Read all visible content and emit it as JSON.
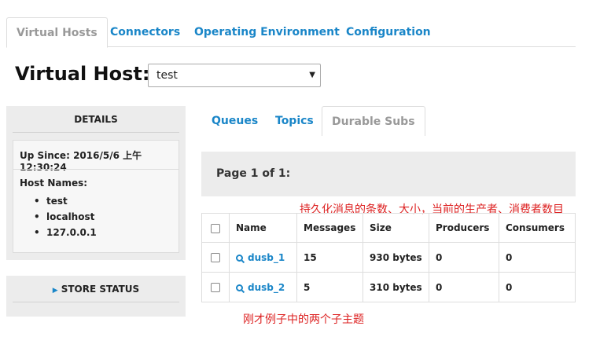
{
  "top_tabs": [
    {
      "label": "Virtual Hosts",
      "active": true
    },
    {
      "label": "Connectors",
      "active": false
    },
    {
      "label": "Operating Environment",
      "active": false
    },
    {
      "label": "Configuration",
      "active": false
    }
  ],
  "virtual_host": {
    "title": "Virtual Host:",
    "selected": "test"
  },
  "details": {
    "header": "DETAILS",
    "up_since_label": "Up Since:",
    "up_since_value": "2016/5/6 上午12:30:24",
    "host_names_label": "Host Names:",
    "host_names": [
      "test",
      "localhost",
      "127.0.0.1"
    ]
  },
  "store_status": {
    "label": "STORE STATUS"
  },
  "sub_tabs": [
    {
      "label": "Queues",
      "active": false
    },
    {
      "label": "Topics",
      "active": false
    },
    {
      "label": "Durable Subs",
      "active": true
    }
  ],
  "pager": {
    "text": "Page 1 of 1:"
  },
  "annotations": {
    "columns_note": "持久化消息的条数、大小，当前的生产者、消费者数目",
    "rows_note": "刚才例子中的两个子主题"
  },
  "table": {
    "columns": [
      "Name",
      "Messages",
      "Size",
      "Producers",
      "Consumers"
    ],
    "rows": [
      {
        "name": "dusb_1",
        "messages": "15",
        "size": "930 bytes",
        "producers": "0",
        "consumers": "0"
      },
      {
        "name": "dusb_2",
        "messages": "5",
        "size": "310 bytes",
        "producers": "0",
        "consumers": "0"
      }
    ]
  },
  "colors": {
    "link": "#1a86c8",
    "annotation": "#dd2222",
    "panel": "#ececec"
  },
  "icons": {
    "row_link": "magnifier-icon",
    "store_toggle": "triangle-right-icon",
    "select_caret": "caret-down-icon"
  }
}
